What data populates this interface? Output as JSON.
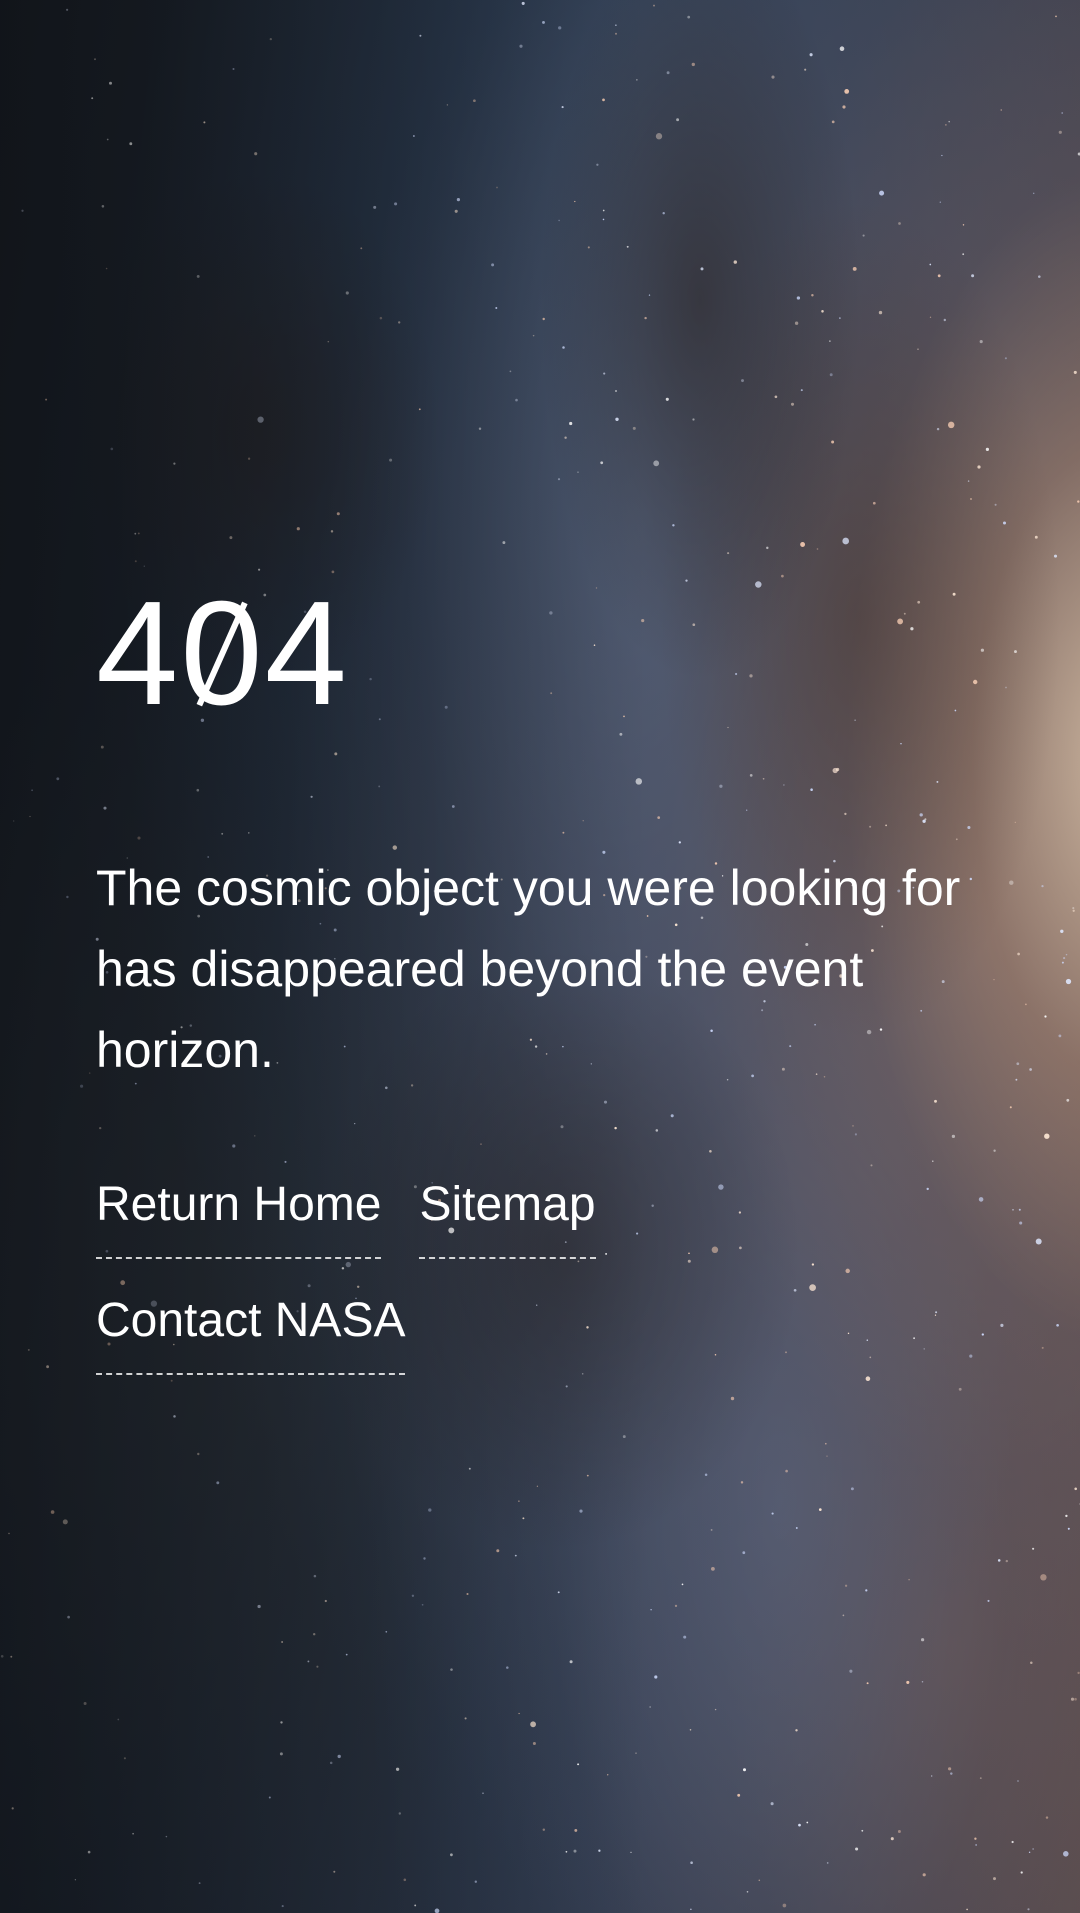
{
  "error": {
    "code_digits": [
      "4",
      "0",
      "4"
    ]
  },
  "message": "The cosmic object you were looking for has disappeared beyond the event horizon.",
  "links": {
    "home": "Return Home",
    "sitemap": "Sitemap",
    "contact": "Contact NASA"
  },
  "colors": {
    "text": "#ffffff",
    "background_dark": "#141a24",
    "galaxy_core": "#dcc4aa",
    "galaxy_arm_blue": "#5a78a0"
  }
}
